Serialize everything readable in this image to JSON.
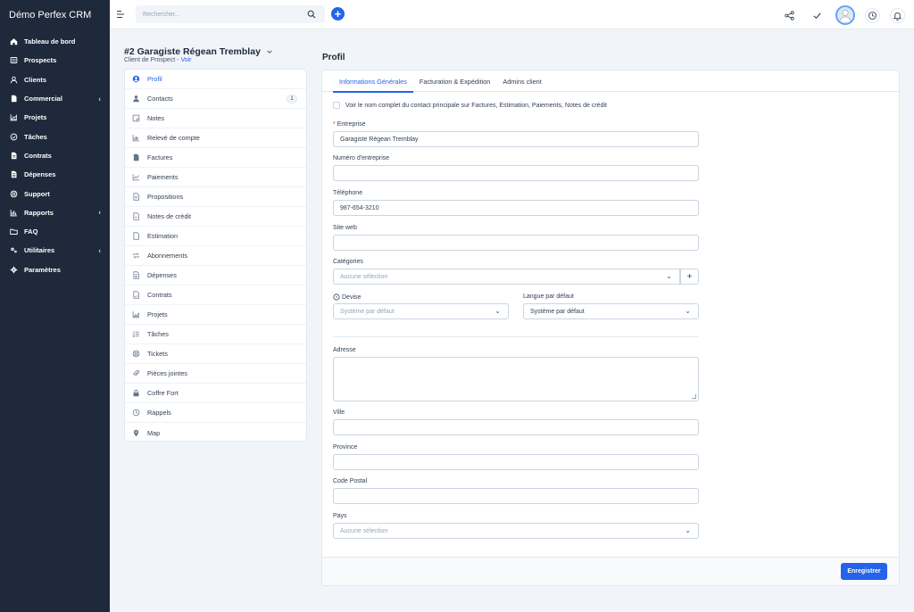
{
  "brand": "Démo Perfex CRM",
  "sidebar": {
    "items": [
      {
        "label": "Tableau de bord",
        "icon": "home-icon"
      },
      {
        "label": "Prospects",
        "icon": "tty-icon"
      },
      {
        "label": "Clients",
        "icon": "user-icon"
      },
      {
        "label": "Commercial",
        "icon": "file-icon",
        "chevron": "‹"
      },
      {
        "label": "Projets",
        "icon": "chart-area-icon"
      },
      {
        "label": "Tâches",
        "icon": "check-circle-icon"
      },
      {
        "label": "Contrats",
        "icon": "file-contract-icon"
      },
      {
        "label": "Dépenses",
        "icon": "file-lines-icon"
      },
      {
        "label": "Support",
        "icon": "life-ring-icon"
      },
      {
        "label": "Rapports",
        "icon": "bar-chart-icon",
        "chevron": "‹"
      },
      {
        "label": "FAQ",
        "icon": "folder-icon"
      },
      {
        "label": "Utilitaires",
        "icon": "cogs-icon",
        "chevron": "‹"
      },
      {
        "label": "Paramètres",
        "icon": "gear-icon"
      }
    ]
  },
  "topbar": {
    "search_placeholder": "Rechercher...",
    "plus": "+"
  },
  "client": {
    "title": "#2 Garagiste Régean Tremblay",
    "subtitle": "Client de Prospect",
    "separator": " - ",
    "view_link": "Voir"
  },
  "client_menu": [
    {
      "label": "Profil",
      "icon": "user-circle-icon",
      "active": true
    },
    {
      "label": "Contacts",
      "icon": "users-icon",
      "badge": "1"
    },
    {
      "label": "Notes",
      "icon": "note-icon"
    },
    {
      "label": "Relevé de compte",
      "icon": "area-chart-icon"
    },
    {
      "label": "Factures",
      "icon": "invoice-icon"
    },
    {
      "label": "Paiements",
      "icon": "line-chart-icon"
    },
    {
      "label": "Propositions",
      "icon": "file-text-icon"
    },
    {
      "label": "Notes de crédit",
      "icon": "file-alt-icon"
    },
    {
      "label": "Estimation",
      "icon": "clipboard-icon"
    },
    {
      "label": "Abonnements",
      "icon": "repeat-icon"
    },
    {
      "label": "Dépenses",
      "icon": "file-lines-icon"
    },
    {
      "label": "Contrats",
      "icon": "contract-icon"
    },
    {
      "label": "Projets",
      "icon": "chart-area-icon"
    },
    {
      "label": "Tâches",
      "icon": "tasks-icon"
    },
    {
      "label": "Tickets",
      "icon": "life-ring-icon"
    },
    {
      "label": "Pièces jointes",
      "icon": "paperclip-icon"
    },
    {
      "label": "Coffre Fort",
      "icon": "lock-icon"
    },
    {
      "label": "Rappels",
      "icon": "clock-icon"
    },
    {
      "label": "Map",
      "icon": "map-marker-icon"
    }
  ],
  "panel": {
    "title": "Profil",
    "tabs": [
      "Informations Générales",
      "Facturation & Expédition",
      "Admins client"
    ]
  },
  "form": {
    "show_contact_label": "Voir le nom complet du contact principale sur Factures, Estimation, Paiements, Notes de crédit",
    "company_label": "Entreprise",
    "company_required": "*",
    "company_value": "Garagiste Régean Tremblay",
    "vat_label": "Numéro d'entreprise",
    "vat_value": "",
    "phone_label": "Téléphone",
    "phone_value": "987-654-3210",
    "website_label": "Site web",
    "website_value": "",
    "groups_label": "Catégories",
    "groups_placeholder": "Aucune sélection",
    "currency_label": "Devise",
    "currency_placeholder": "Système par défaut",
    "language_label": "Langue par défaut",
    "language_value": "Système par défaut",
    "address_label": "Adresse",
    "city_label": "Ville",
    "state_label": "Province",
    "zip_label": "Code Postal",
    "country_label": "Pays",
    "country_placeholder": "Aucune sélection"
  },
  "footer": {
    "save_label": "Enregistrer"
  },
  "colors": {
    "accent": "#2563eb",
    "sidebar_bg": "#1e293b"
  }
}
